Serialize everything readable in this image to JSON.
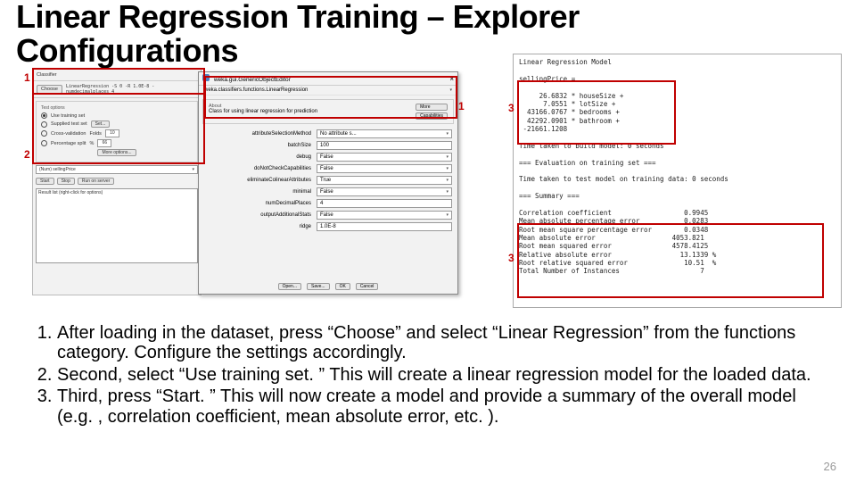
{
  "title_line1": "Linear Regression Training – Explorer",
  "title_line2": "Configurations",
  "classify": {
    "section": "Classifier",
    "choose": "Choose",
    "scheme": "LinearRegression -S 0 -R 1.0E-8 -numdecimalplaces 4",
    "test_options_label": "Test options",
    "opt_use_training": "Use training set",
    "opt_supplied": "Supplied test set",
    "opt_supplied_btn": "Set...",
    "opt_cv": "Cross-validation",
    "opt_cv_label": "Folds",
    "opt_cv_val": "10",
    "opt_split": "Percentage split",
    "opt_split_label": "%",
    "opt_split_val": "66",
    "more_options": "More options...",
    "class_combo": "(Num) sellingPrice",
    "btn_start": "Start",
    "btn_stop": "Stop",
    "btn_run": "Run on server",
    "result_list_label": "Result list (right-click for options)"
  },
  "goe": {
    "window_title": "weka.gui.GenericObjectEditor",
    "header": "weka.classifiers.functions.LinearRegression",
    "about_label": "About",
    "about_text": "Class for using linear regression for prediction",
    "btn_more": "More",
    "btn_caps": "Capabilities",
    "props": [
      {
        "lbl": "attributeSelectionMethod",
        "val": "No attribute s..."
      },
      {
        "lbl": "batchSize",
        "val": "100"
      },
      {
        "lbl": "debug",
        "val": "False"
      },
      {
        "lbl": "doNotCheckCapabilities",
        "val": "False"
      },
      {
        "lbl": "eliminateColinearAttributes",
        "val": "True"
      },
      {
        "lbl": "minimal",
        "val": "False"
      },
      {
        "lbl": "numDecimalPlaces",
        "val": "4"
      },
      {
        "lbl": "outputAdditionalStats",
        "val": "False"
      },
      {
        "lbl": "ridge",
        "val": "1.0E-8"
      }
    ],
    "btn_open": "Open...",
    "btn_save": "Save...",
    "btn_ok": "OK",
    "btn_cancel": "Cancel"
  },
  "output": {
    "head": "Linear Regression Model",
    "equation": "sellingPrice =",
    "coef1": "     26.6832 * houseSize +",
    "coef2": "      7.0551 * lotSize +",
    "coef3": "  43166.0767 * bedrooms +",
    "coef4": "  42292.0901 * bathroom +",
    "coef5": " -21661.1208",
    "build_time": "Time taken to build model: 0 seconds",
    "eval_header": "=== Evaluation on training set ===",
    "test_time": "Time taken to test model on training data: 0 seconds",
    "summary_header": "=== Summary ===",
    "m1": "Correlation coefficient                  0.9945",
    "m2": "Mean absolute percentage error           0.0283",
    "m3": "Root mean square percentage error        0.0348",
    "m4": "Mean absolute error                   4053.821",
    "m5": "Root mean squared error               4578.4125",
    "m6": "Relative absolute error                 13.1339 %",
    "m7": "Root relative squared error              10.51  %",
    "m8": "Total Number of Instances                    7"
  },
  "labels": {
    "n1a": "1",
    "n1b": "1",
    "n2": "2",
    "n3a": "3",
    "n3b": "3"
  },
  "steps": {
    "s1": "After loading in the dataset, press “Choose” and select “Linear Regression” from the functions category. Configure the settings accordingly.",
    "s2": "Second, select “Use training set. ” This will create a linear regression model for the loaded data.",
    "s3": "Third, press “Start. ” This will now create a model and provide a summary of the overall model (e.g. , correlation coefficient, mean absolute error, etc. )."
  },
  "page_number": "26"
}
